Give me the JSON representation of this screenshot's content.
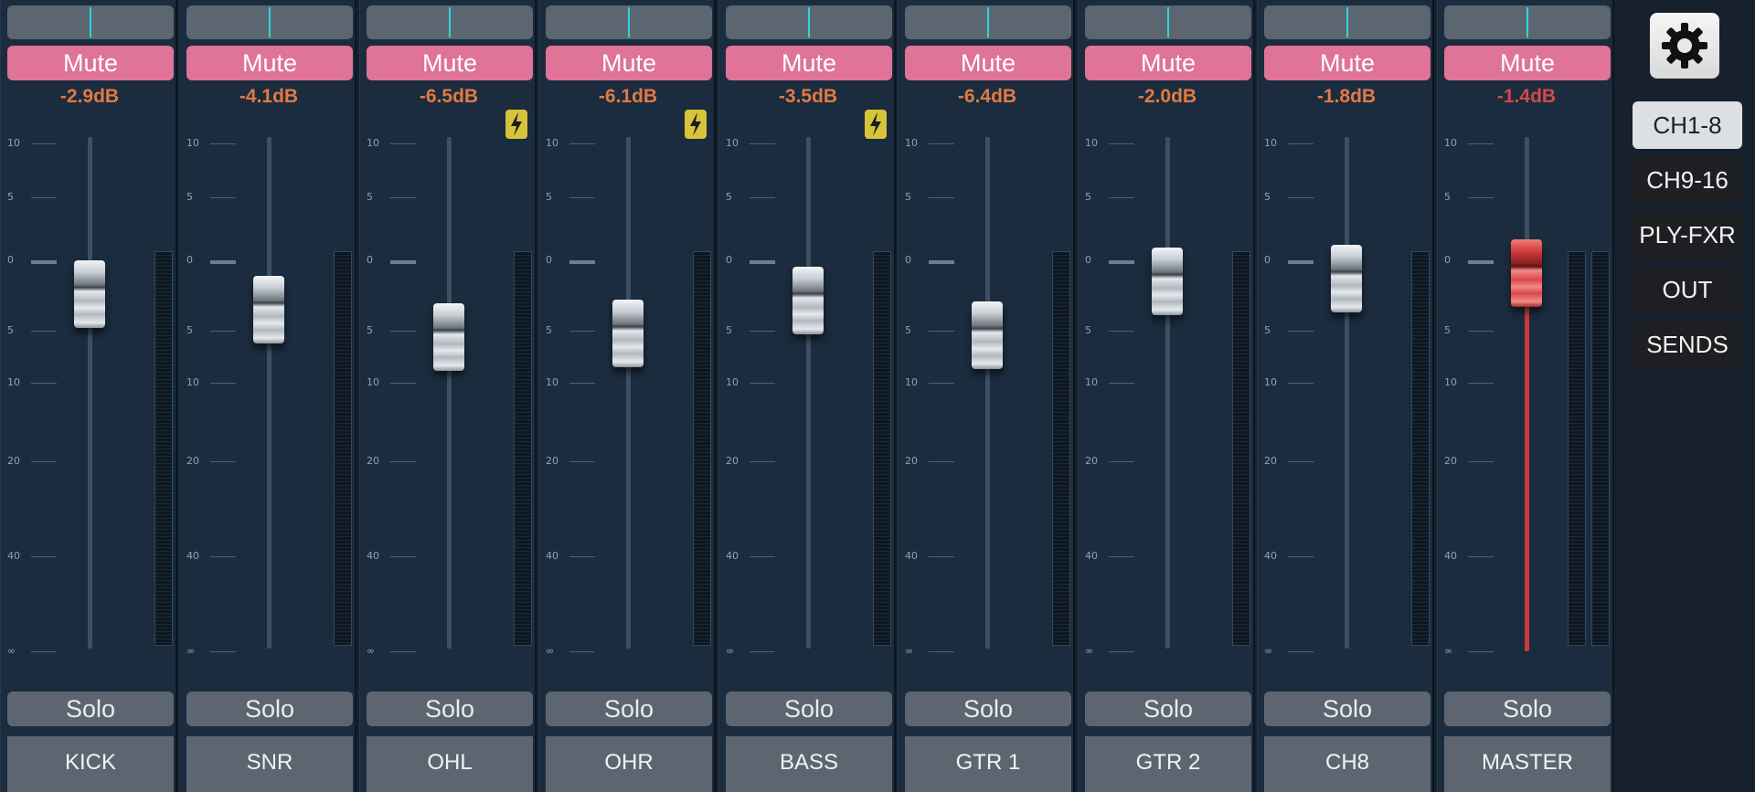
{
  "channels": [
    {
      "name": "KICK",
      "mute_label": "Mute",
      "solo_label": "Solo",
      "db": "-2.9dB",
      "clip": false,
      "pan": 0.5
    },
    {
      "name": "SNR",
      "mute_label": "Mute",
      "solo_label": "Solo",
      "db": "-4.1dB",
      "clip": false,
      "pan": 0.5
    },
    {
      "name": "OHL",
      "mute_label": "Mute",
      "solo_label": "Solo",
      "db": "-6.5dB",
      "clip": true,
      "pan": 0.5
    },
    {
      "name": "OHR",
      "mute_label": "Mute",
      "solo_label": "Solo",
      "db": "-6.1dB",
      "clip": true,
      "pan": 0.5
    },
    {
      "name": "BASS",
      "mute_label": "Mute",
      "solo_label": "Solo",
      "db": "-3.5dB",
      "clip": true,
      "pan": 0.5
    },
    {
      "name": "GTR 1",
      "mute_label": "Mute",
      "solo_label": "Solo",
      "db": "-6.4dB",
      "clip": false,
      "pan": 0.5
    },
    {
      "name": "GTR 2",
      "mute_label": "Mute",
      "solo_label": "Solo",
      "db": "-2.0dB",
      "clip": false,
      "pan": 0.5
    },
    {
      "name": "CH8",
      "mute_label": "Mute",
      "solo_label": "Solo",
      "db": "-1.8dB",
      "clip": false,
      "pan": 0.5
    },
    {
      "name": "MASTER",
      "mute_label": "Mute",
      "solo_label": "Solo",
      "db": "-1.4dB",
      "clip": false,
      "pan": 0.5,
      "is_master": true
    }
  ],
  "scale_labels": [
    "10",
    "5",
    "0",
    "5",
    "10",
    "20",
    "40",
    "∞"
  ],
  "nav": {
    "items": [
      {
        "label": "CH1-8",
        "active": true
      },
      {
        "label": "CH9-16",
        "active": false
      },
      {
        "label": "PLY-FXR",
        "active": false
      },
      {
        "label": "OUT",
        "active": false
      },
      {
        "label": "SENDS",
        "active": false
      }
    ]
  },
  "icons": {
    "settings": "gear-icon",
    "clip": "lightning-icon"
  },
  "colors": {
    "mute": "#df7398",
    "db": "#e07a44",
    "master_db": "#d24a4a",
    "pan_indicator": "#2fd3e0",
    "master_fader": "#d23a3a"
  }
}
